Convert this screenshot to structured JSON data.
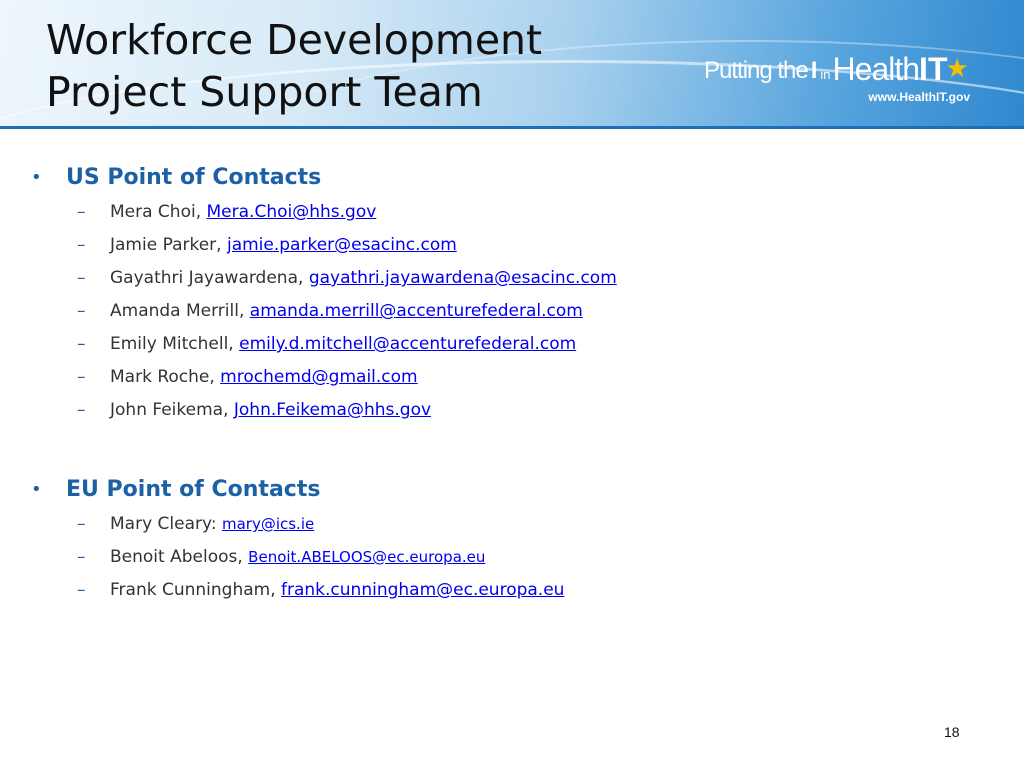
{
  "title_line1": "Workforce Development",
  "title_line2": "Project Support Team",
  "logo": {
    "putting": "Putting the",
    "i": "I",
    "in": "in",
    "health": "Health",
    "it": "IT",
    "url": "www.HealthIT.gov"
  },
  "sections": [
    {
      "heading": "US Point of Contacts",
      "contacts": [
        {
          "name": "Mera Choi,",
          "email": "Mera.Choi@hhs.gov"
        },
        {
          "name": "Jamie Parker,",
          "email": "jamie.parker@esacinc.com"
        },
        {
          "name": "Gayathri Jayawardena,",
          "email": "gayathri.jayawardena@esacinc.com"
        },
        {
          "name": "Amanda Merrill,",
          "email": "amanda.merrill@accenturefederal.com"
        },
        {
          "name": "Emily Mitchell,",
          "email": "emily.d.mitchell@accenturefederal.com"
        },
        {
          "name": "Mark Roche,",
          "email": "mrochemd@gmail.com"
        },
        {
          "name": "John Feikema,",
          "email": "John.Feikema@hhs.gov"
        }
      ]
    },
    {
      "heading": "EU Point of Contacts",
      "contacts": [
        {
          "name": "Mary Cleary:",
          "email": "mary@ics.ie"
        },
        {
          "name": "Benoit Abeloos,",
          "email": "Benoit.ABELOOS@ec.europa.eu"
        },
        {
          "name": "Frank Cunningham,",
          "email": "frank.cunningham@ec.europa.eu"
        }
      ]
    }
  ],
  "page_number": "18",
  "colors": {
    "heading": "#1c61a6",
    "link": "#0000ee",
    "body_text": "#333333",
    "header_accent": "#1f6fb8"
  }
}
